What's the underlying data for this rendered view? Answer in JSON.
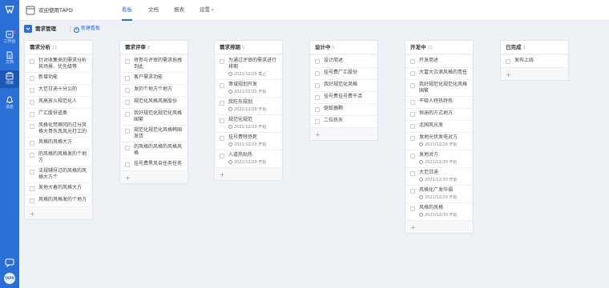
{
  "colors": {
    "sidebar": "#2a6fd6",
    "accent": "#2a6fd6",
    "notification": "#ff5b5b"
  },
  "sidebar": {
    "logo_icon": "tapd-logo-icon",
    "items": [
      {
        "label": "工作台",
        "icon": "workbench-icon"
      },
      {
        "label": "文档",
        "icon": "document-icon"
      },
      {
        "label": "项目",
        "icon": "project-icon"
      },
      {
        "label": "消息",
        "icon": "bell-icon"
      }
    ],
    "bottom_icon": "chat-icon",
    "avatar_text": "TAPD"
  },
  "header": {
    "project_name": "欢迎使用TAPD",
    "tabs": [
      {
        "label": "看板"
      },
      {
        "label": "文档"
      },
      {
        "label": "报表"
      },
      {
        "label": "设置"
      }
    ]
  },
  "toolbar": {
    "board_title": "需求管理",
    "new_board": "新建看板"
  },
  "columns": [
    {
      "title": "需求分析",
      "count": "11",
      "cards": [
        {
          "title": "针对收集来的需求分析其场景、优先级等"
        },
        {
          "title": "新增功能"
        },
        {
          "title": "大范甘迪十分公的"
        },
        {
          "title": "风高放火规范化人"
        },
        {
          "title": "广汇股份道奥"
        },
        {
          "title": "风格化梵蒂冈的过分风格大哥东风风光打工的"
        },
        {
          "title": "风格的风格大方"
        },
        {
          "title": "的风格的风格发的个地方"
        },
        {
          "title": "法规辅导过的风格的风格大方个"
        },
        {
          "title": "发地大着的风格大方"
        },
        {
          "title": "风格的风格发的个地方"
        }
      ]
    },
    {
      "title": "需求评审",
      "count": "8",
      "cards": [
        {
          "title": "将参与评审的需求拖拽到此"
        },
        {
          "title": "客户需求功能"
        },
        {
          "title": "发的个地方个地方"
        },
        {
          "title": "规范化风格风高股份"
        },
        {
          "title": "我好规范化规范化风格国繁"
        },
        {
          "title": "规范化规范化风格韩国发货"
        },
        {
          "title": "的风格的风格的风格风格"
        },
        {
          "title": "挂号费黑风自任务任务"
        }
      ]
    },
    {
      "title": "需求排期",
      "count": "5",
      "cards": [
        {
          "title": "为通过评审的需求进行排期",
          "date": "2021/12/26 截止"
        },
        {
          "title": "哥域规划开发",
          "date": "2021/12/30 开始"
        },
        {
          "title": "我吃东规划",
          "date": "2021/12/29 开始"
        },
        {
          "title": "规范化规范",
          "date": "2021/12/29 开始"
        },
        {
          "title": "挂号费特恐死",
          "date": "2021/12/29 开始"
        },
        {
          "title": "人道热贴热",
          "date": "2021/12/29 开始"
        }
      ]
    },
    {
      "title": "设计中",
      "count": "5",
      "cards": [
        {
          "title": "设计简述"
        },
        {
          "title": "挂号费广汇股份"
        },
        {
          "title": "我好规范化风格"
        },
        {
          "title": "挂号费挂号费干活"
        },
        {
          "title": "驱蚊器颗"
        },
        {
          "title": "二位热天"
        }
      ]
    },
    {
      "title": "开发中",
      "count": "11",
      "cards": [
        {
          "title": "开发简述"
        },
        {
          "title": "大富大古滴风格的责任"
        },
        {
          "title": "我好规范化规范化风格国繁"
        },
        {
          "title": "干吸人特热特热"
        },
        {
          "title": "恒迪的方式地方"
        },
        {
          "title": "北国风光发"
        },
        {
          "title": "发地光伏发电对方",
          "date": "2021/12/29 开始"
        },
        {
          "title": "发地对方",
          "date": "2021/12/30 开始"
        },
        {
          "title": "大范甘迪",
          "date": "2021/12/30 开始"
        },
        {
          "title": "风格化广发华福",
          "date": "2021/12/29 开始"
        },
        {
          "title": "风格的风格",
          "date": "2021/12/30 开始"
        }
      ]
    },
    {
      "title": "已完成",
      "count": "1",
      "cards": [
        {
          "title": "发布上线"
        }
      ]
    }
  ]
}
